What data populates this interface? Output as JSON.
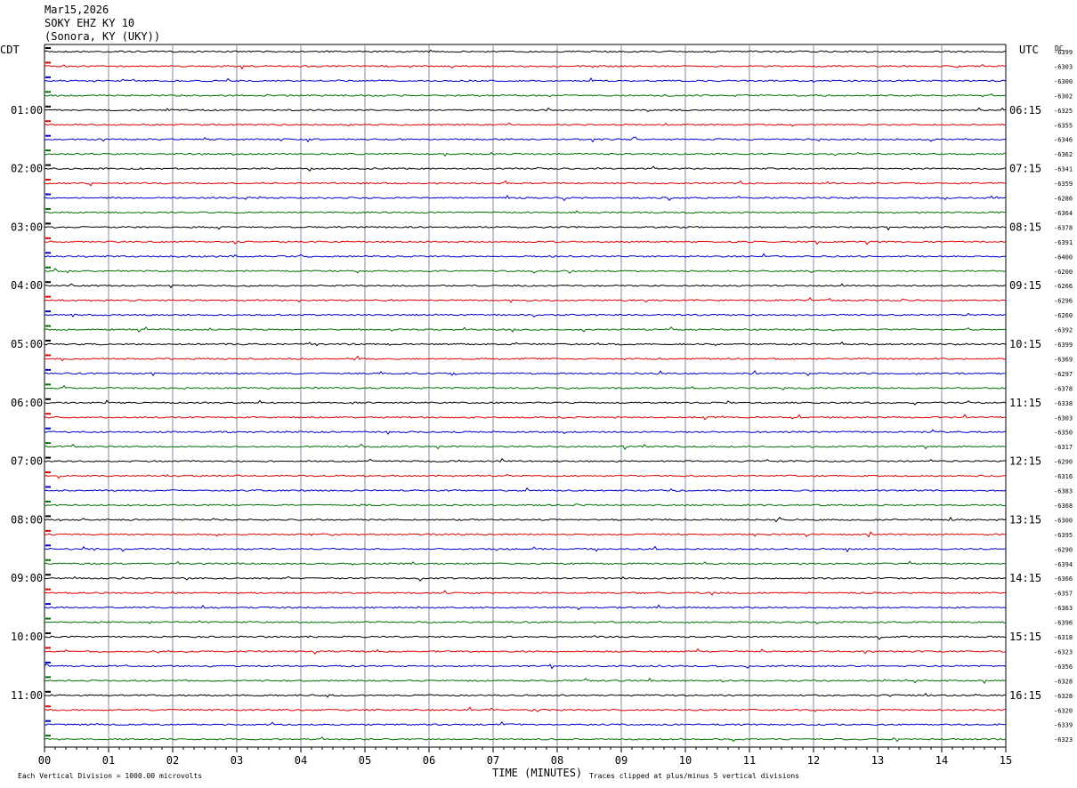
{
  "header": {
    "date": "Mar15,2026",
    "station": "SOKY EHZ KY 10",
    "location": "(Sonora, KY (UKY))"
  },
  "left_tz": "CDT",
  "right_tz": "UTC",
  "dc_label": "DC",
  "footer": {
    "xlabel": "TIME (MINUTES)",
    "scale_note": "Each Vertical Division = 1000.00 microvolts",
    "clip_note": "Traces clipped at plus/minus 5 vertical divisions"
  },
  "chart_data": {
    "type": "line",
    "title": "SOKY EHZ KY 10",
    "xlabel": "TIME (MINUTES)",
    "xlim": [
      0,
      15
    ],
    "x_ticks": [
      "00",
      "01",
      "02",
      "03",
      "04",
      "05",
      "06",
      "07",
      "08",
      "09",
      "10",
      "11",
      "12",
      "13",
      "14",
      "15"
    ],
    "trace_count": 48,
    "trace_colors": [
      "#000000",
      "#e00000",
      "#0000cc",
      "#007000"
    ],
    "left_hour_labels": [
      "01:00",
      "02:00",
      "03:00",
      "04:00",
      "05:00",
      "06:00",
      "07:00",
      "08:00",
      "09:00",
      "10:00",
      "11:00"
    ],
    "right_hour_labels": [
      "06:15",
      "07:15",
      "08:15",
      "09:15",
      "10:15",
      "11:15",
      "12:15",
      "13:15",
      "14:15",
      "15:15",
      "16:15"
    ],
    "hour_label_first_trace": 4,
    "hour_label_every": 4,
    "dc_offsets": [
      "-6399",
      "-6303",
      "-6300",
      "-6302",
      "-6325",
      "-6355",
      "-6346",
      "-6362",
      "-6341",
      "-6359",
      "-6286",
      "-6364",
      "-6378",
      "-6391",
      "-6400",
      "-6200",
      "-6266",
      "-6296",
      "-6260",
      "-6392",
      "-6399",
      "-6369",
      "-6297",
      "-6378",
      "-6338",
      "-6303",
      "-6350",
      "-6317",
      "-6290",
      "-6316",
      "-6383",
      "-6368",
      "-6300",
      "-6395",
      "-6290",
      "-6394",
      "-6366",
      "-6357",
      "-6363",
      "-6396",
      "-6318",
      "-6323",
      "-6356",
      "-6328",
      "-6328",
      "-6320",
      "-6339",
      "-6323"
    ]
  }
}
